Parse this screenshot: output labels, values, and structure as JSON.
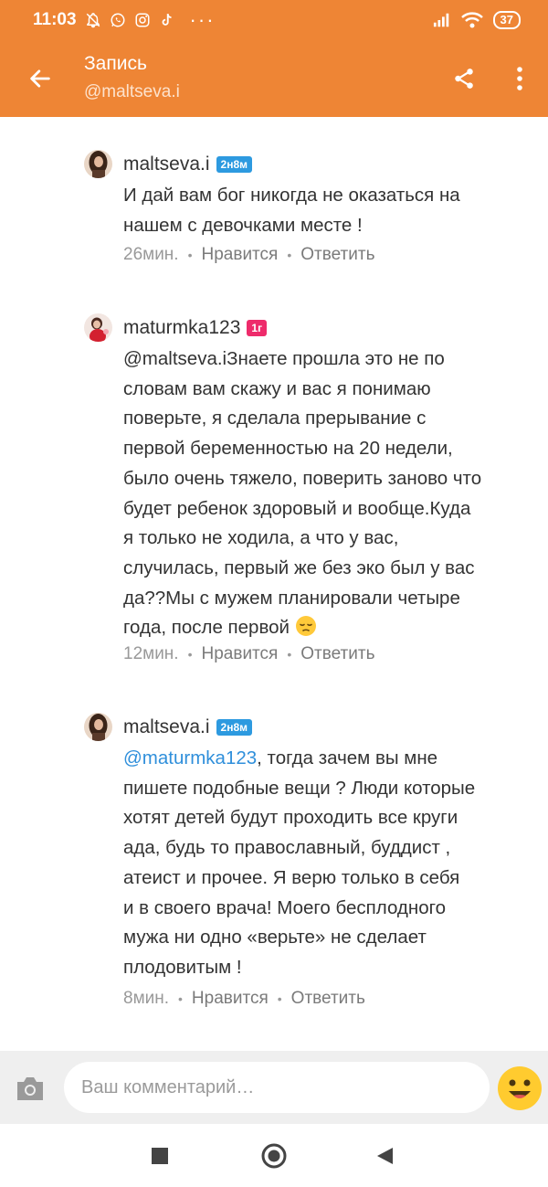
{
  "status_bar": {
    "time": "11:03",
    "dots": "···",
    "battery": "37",
    "icons": [
      "notifications-off-icon",
      "whatsapp-icon",
      "instagram-icon",
      "tiktok-icon",
      "signal-icon",
      "wifi-icon",
      "battery-icon"
    ]
  },
  "header": {
    "title": "Запись",
    "subtitle": "@maltseva.i",
    "accent_color": "#ee8535"
  },
  "comments": [
    {
      "author": "maltseva.i",
      "badge": "2н8м",
      "badge_color": "#2d9ae0",
      "lines": [
        "И дай вам бог никогда не оказаться на",
        "нашем с девочками месте !"
      ],
      "time": "26мин.",
      "like": "Нравится",
      "reply": "Ответить"
    },
    {
      "author": "maturmka123",
      "badge": "1г",
      "badge_color": "#ee2b6b",
      "lines": [
        "@maltseva.iЗнаете прошла это не по",
        "словам вам скажу и вас я понимаю",
        "поверьте, я сделала прерывание с",
        "первой беременностью на 20 недели,",
        "было очень тяжело, поверить заново что",
        "будет ребенок здоровый и вообще.Куда",
        "я только не ходила, а что у вас,",
        "случилась, первый же без эко был у вас",
        "да??Мы с мужем планировали четыре",
        "года, после первой"
      ],
      "time": "12мин.",
      "like": "Нравится",
      "reply": "Ответить"
    },
    {
      "author": "maltseva.i",
      "badge": "2н8м",
      "badge_color": "#2d9ae0",
      "mention": "@maturmka123",
      "lines": [
        ", тогда зачем вы мне",
        "пишете подобные вещи ? Люди которые",
        "хотят детей будут проходить все круги",
        "ада, будь то православный, буддист ,",
        "атеист и прочее. Я верю только в себя",
        "и в своего врача! Моего бесплодного",
        "мужа ни одно «верьте» не сделает",
        "плодовитым !"
      ],
      "time": "8мин.",
      "like": "Нравится",
      "reply": "Ответить"
    }
  ],
  "input": {
    "placeholder": "Ваш комментарий…"
  },
  "meta_dot": "•"
}
